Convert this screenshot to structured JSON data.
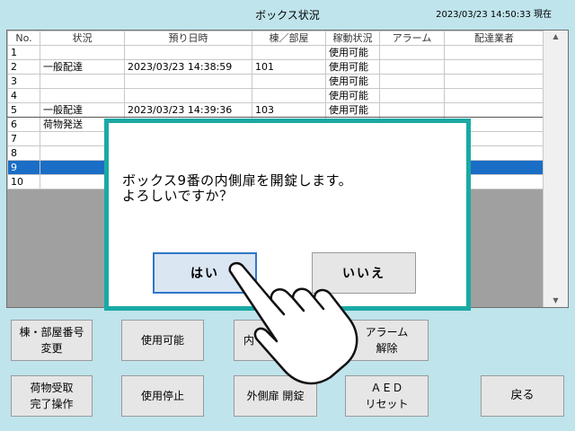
{
  "header": {
    "title": "ボックス状況",
    "datetime": "2023/03/23 14:50:33 現在"
  },
  "table": {
    "columns": [
      "No.",
      "状況",
      "預り日時",
      "棟／部屋",
      "稼動状況",
      "アラーム",
      "配達業者"
    ],
    "rows": [
      {
        "no": "1",
        "status": "",
        "datetime": "",
        "room": "",
        "operation": "使用可能",
        "alarm": "",
        "carrier": ""
      },
      {
        "no": "2",
        "status": "一般配達",
        "datetime": "2023/03/23 14:38:59",
        "room": "101",
        "operation": "使用可能",
        "alarm": "",
        "carrier": ""
      },
      {
        "no": "3",
        "status": "",
        "datetime": "",
        "room": "",
        "operation": "使用可能",
        "alarm": "",
        "carrier": ""
      },
      {
        "no": "4",
        "status": "",
        "datetime": "",
        "room": "",
        "operation": "使用可能",
        "alarm": "",
        "carrier": ""
      },
      {
        "no": "5",
        "status": "一般配達",
        "datetime": "2023/03/23 14:39:36",
        "room": "103",
        "operation": "使用可能",
        "alarm": "",
        "carrier": ""
      },
      {
        "no": "6",
        "status": "荷物発送",
        "datetime": "",
        "room": "",
        "operation": "",
        "alarm": "",
        "carrier": ""
      },
      {
        "no": "7",
        "status": "",
        "datetime": "",
        "room": "",
        "operation": "",
        "alarm": "",
        "carrier": ""
      },
      {
        "no": "8",
        "status": "",
        "datetime": "",
        "room": "",
        "operation": "",
        "alarm": "",
        "carrier": ""
      },
      {
        "no": "9",
        "status": "",
        "datetime": "",
        "room": "",
        "operation": "",
        "alarm": "",
        "carrier": ""
      },
      {
        "no": "10",
        "status": "",
        "datetime": "",
        "room": "",
        "operation": "",
        "alarm": "",
        "carrier": ""
      }
    ],
    "selected_row": "9"
  },
  "buttons": {
    "change_room": "棟・部屋番号\n変更",
    "enable": "使用可能",
    "inner_door": "内",
    "alarm_reset": "アラーム\n解除",
    "receive_complete": "荷物受取\n完了操作",
    "disable": "使用停止",
    "outer_door_unlock": "外側扉 開錠",
    "aed_reset": "ＡＥＤ\nリセット",
    "back": "戻る"
  },
  "dialog": {
    "message": "ボックス9番の内側扉を開錠します。\nよろしいですか？",
    "yes": "はい",
    "no": "いいえ"
  },
  "colors": {
    "background": "#bfe4ec",
    "dialog_border": "#1aa9a4",
    "selected_row": "#1a6ec6"
  },
  "icons": {
    "pointer": "pointing-hand-icon",
    "scroll_up": "scroll-up-arrow-icon",
    "scroll_down": "scroll-down-arrow-icon"
  }
}
